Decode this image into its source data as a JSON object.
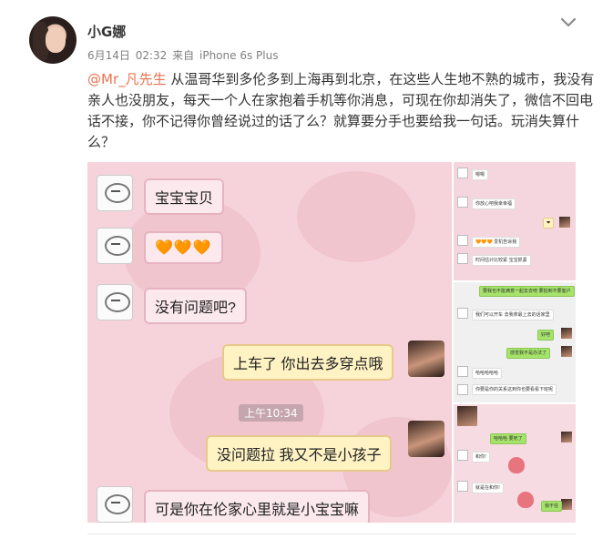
{
  "post": {
    "username": "小G娜",
    "date": "6月14日",
    "time": "02:32",
    "source_prefix": "来自",
    "source": "iPhone 6s Plus",
    "mention": "@Mr_凡先生",
    "text": " 从温哥华到多伦多到上海再到北京，在这些人生地不熟的城市，我没有亲人也没朋友，每天一个人在家抱着手机等你消息，可现在你却消失了，微信不回电话不接，你不记得你曾经说过的话了么？就算要分手也要给我一句话。玩消失算什么？"
  },
  "chat": {
    "msg1": "宝宝宝贝",
    "msg2_hearts": "🧡🧡🧡",
    "msg3": "没有问题吧?",
    "msg4": "上车了 你出去多穿点哦",
    "timestamp": "上午10:34",
    "msg5": "没问题拉 我又不是小孩子",
    "msg6": "可是你在伦家心里就是小宝宝嘛"
  },
  "thumbs": {
    "t1": [
      "嗯嗯",
      "你放心吧我幸幸福",
      "🧡🧡🧡 爱机告诉我",
      "时间估计比较紧 宝宝抓紧"
    ],
    "t2": [
      "要我也不能满意一起去去吧 要拍到不要客户",
      "我们可以开车 去我拿最上去的话家里",
      "好吧",
      "感觉我不是办法了",
      "哈哈哈哈哈",
      "你要是你的关系这到你也要看看下班呢"
    ],
    "t3": [
      "哈哈哈 要死了",
      "和你!",
      "就是在和你!",
      "我不信"
    ]
  },
  "colors": {
    "mention": "#eb7350",
    "meta": "#808080",
    "chat_bg": "#f6d3da",
    "bubble_right": "#fff3c4",
    "wechat_green": "#a6e36a"
  },
  "icons": {
    "menu": "chevron-down-icon"
  }
}
